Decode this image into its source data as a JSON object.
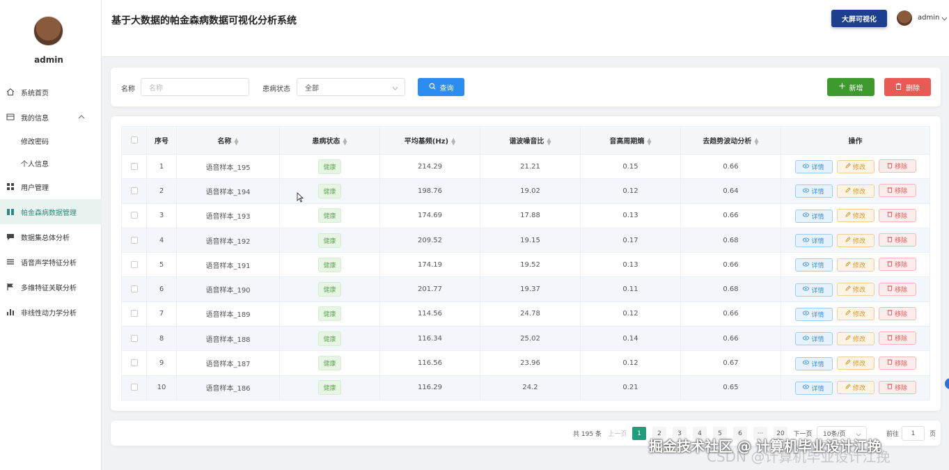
{
  "sidebar": {
    "username": "admin",
    "items": [
      {
        "label": "系统首页",
        "icon": "home-icon"
      },
      {
        "label": "我的信息",
        "icon": "profile-icon"
      },
      {
        "label": "修改密码"
      },
      {
        "label": "个人信息"
      },
      {
        "label": "用户管理",
        "icon": "grid-icon"
      },
      {
        "label": "帕金森病数据管理",
        "icon": "book-icon"
      },
      {
        "label": "数据集总体分析",
        "icon": "chat-icon"
      },
      {
        "label": "语音声学特征分析",
        "icon": "list-icon"
      },
      {
        "label": "多维特征关联分析",
        "icon": "flag-icon"
      },
      {
        "label": "非线性动力学分析",
        "icon": "bar-chart-icon"
      }
    ]
  },
  "header": {
    "title": "基于大数据的帕金森病数据可视化分析系统",
    "dashboard_button": "大屏可视化",
    "username": "admin"
  },
  "search": {
    "name_label": "名称",
    "name_placeholder": "名称",
    "status_label": "患病状态",
    "status_value": "全部",
    "query_button": "查询",
    "add_button": "新增",
    "delete_button": "删除"
  },
  "table": {
    "columns": [
      "序号",
      "名称",
      "患病状态",
      "平均基频(Hz)",
      "谐波噪音比",
      "音高周期熵",
      "去趋势波动分析",
      "操作"
    ],
    "actions": {
      "detail": "详情",
      "edit": "修改",
      "remove": "移除"
    },
    "rows": [
      {
        "no": "1",
        "name": "语音样本_195",
        "status": "健康",
        "f0": "214.29",
        "hnr": "21.21",
        "ppe": "0.15",
        "dfa": "0.66"
      },
      {
        "no": "2",
        "name": "语音样本_194",
        "status": "健康",
        "f0": "198.76",
        "hnr": "19.02",
        "ppe": "0.12",
        "dfa": "0.64"
      },
      {
        "no": "3",
        "name": "语音样本_193",
        "status": "健康",
        "f0": "174.69",
        "hnr": "17.88",
        "ppe": "0.13",
        "dfa": "0.66"
      },
      {
        "no": "4",
        "name": "语音样本_192",
        "status": "健康",
        "f0": "209.52",
        "hnr": "19.15",
        "ppe": "0.17",
        "dfa": "0.68"
      },
      {
        "no": "5",
        "name": "语音样本_191",
        "status": "健康",
        "f0": "174.19",
        "hnr": "19.52",
        "ppe": "0.13",
        "dfa": "0.66"
      },
      {
        "no": "6",
        "name": "语音样本_190",
        "status": "健康",
        "f0": "201.77",
        "hnr": "19.37",
        "ppe": "0.11",
        "dfa": "0.68"
      },
      {
        "no": "7",
        "name": "语音样本_189",
        "status": "健康",
        "f0": "114.56",
        "hnr": "24.78",
        "ppe": "0.12",
        "dfa": "0.66"
      },
      {
        "no": "8",
        "name": "语音样本_188",
        "status": "健康",
        "f0": "116.34",
        "hnr": "25.02",
        "ppe": "0.14",
        "dfa": "0.66"
      },
      {
        "no": "9",
        "name": "语音样本_187",
        "status": "健康",
        "f0": "116.56",
        "hnr": "23.96",
        "ppe": "0.12",
        "dfa": "0.67"
      },
      {
        "no": "10",
        "name": "语音样本_186",
        "status": "健康",
        "f0": "116.29",
        "hnr": "24.2",
        "ppe": "0.21",
        "dfa": "0.65"
      }
    ]
  },
  "pagination": {
    "total": "共 195 条",
    "prev": "上一页",
    "pages": [
      "1",
      "2",
      "3",
      "4",
      "5",
      "6",
      "···",
      "20"
    ],
    "next": "下一页",
    "page_size": "10条/页",
    "goto_label": "前往",
    "goto_value": "1",
    "page_suffix": "页"
  },
  "watermark": {
    "line1": "掘金技术社区 @ 计算机毕业设计江挽",
    "line2": "CSDN @计算机毕业设计江挽"
  }
}
